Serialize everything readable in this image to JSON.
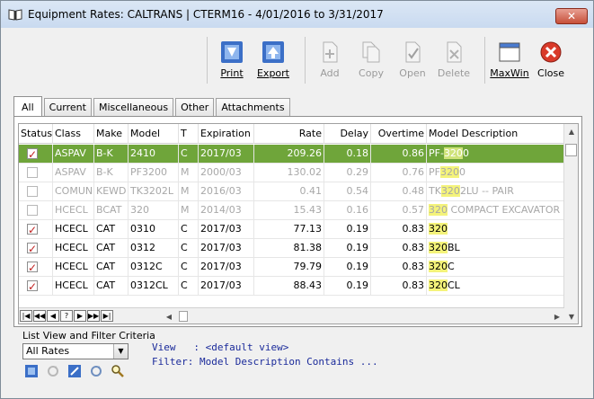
{
  "window": {
    "title": "Equipment Rates: CALTRANS | CTERM16 -  4/01/2016 to  3/31/2017",
    "close_glyph": "✕"
  },
  "toolbar": {
    "print": "Print",
    "export": "Export",
    "add": "Add",
    "copy": "Copy",
    "open": "Open",
    "delete": "Delete",
    "maxwin": "MaxWin",
    "close": "Close"
  },
  "tabs": [
    "All",
    "Current",
    "Miscellaneous",
    "Other",
    "Attachments"
  ],
  "grid": {
    "columns": [
      "Status",
      "Class",
      "Make",
      "Model",
      "T",
      "Expiration",
      "Rate",
      "Delay",
      "Overtime",
      "Model Description"
    ],
    "rows": [
      {
        "checked": true,
        "class": "ASPAV",
        "make": "B-K",
        "model": "2410",
        "t": "C",
        "expiration": "2017/03",
        "rate": "209.26",
        "delay": "0.18",
        "overtime": "0.86",
        "desc_pre": "PF-",
        "desc_hl": "320",
        "desc_post": "0",
        "state": "selected"
      },
      {
        "checked": false,
        "class": "ASPAV",
        "make": "B-K",
        "model": "PF3200",
        "t": "M",
        "expiration": "2000/03",
        "rate": "130.02",
        "delay": "0.29",
        "overtime": "0.76",
        "desc_pre": "PF",
        "desc_hl": "320",
        "desc_post": "0",
        "state": "dim"
      },
      {
        "checked": false,
        "class": "COMUN",
        "make": "KEWD",
        "model": "TK3202L",
        "t": "M",
        "expiration": "2016/03",
        "rate": "0.41",
        "delay": "0.54",
        "overtime": "0.48",
        "desc_pre": "TK",
        "desc_hl": "320",
        "desc_post": "2LU -- PAIR",
        "state": "dim"
      },
      {
        "checked": false,
        "class": "HCECL",
        "make": "BCAT",
        "model": "320",
        "t": "M",
        "expiration": "2014/03",
        "rate": "15.43",
        "delay": "0.16",
        "overtime": "0.57",
        "desc_pre": "",
        "desc_hl": "320",
        "desc_post": " COMPACT EXCAVATOR",
        "state": "dim"
      },
      {
        "checked": true,
        "class": "HCECL",
        "make": "CAT",
        "model": "0310",
        "t": "C",
        "expiration": "2017/03",
        "rate": "77.13",
        "delay": "0.19",
        "overtime": "0.83",
        "desc_pre": "",
        "desc_hl": "320",
        "desc_post": "",
        "state": "normal"
      },
      {
        "checked": true,
        "class": "HCECL",
        "make": "CAT",
        "model": "0312",
        "t": "C",
        "expiration": "2017/03",
        "rate": "81.38",
        "delay": "0.19",
        "overtime": "0.83",
        "desc_pre": "",
        "desc_hl": "320",
        "desc_post": "BL",
        "state": "normal"
      },
      {
        "checked": true,
        "class": "HCECL",
        "make": "CAT",
        "model": "0312C",
        "t": "C",
        "expiration": "2017/03",
        "rate": "79.79",
        "delay": "0.19",
        "overtime": "0.83",
        "desc_pre": "",
        "desc_hl": "320",
        "desc_post": "C",
        "state": "normal"
      },
      {
        "checked": true,
        "class": "HCECL",
        "make": "CAT",
        "model": "0312CL",
        "t": "C",
        "expiration": "2017/03",
        "rate": "88.43",
        "delay": "0.19",
        "overtime": "0.83",
        "desc_pre": "",
        "desc_hl": "320",
        "desc_post": "CL",
        "state": "normal"
      }
    ]
  },
  "navbar": [
    "|◀",
    "◀◀",
    "◀",
    "?",
    "▶",
    "▶▶",
    "▶|"
  ],
  "filter": {
    "label": "List View and Filter Criteria",
    "selected": "All Rates",
    "view_line": "View   : <default view>",
    "filter_line": "Filter: Model Description Contains ..."
  }
}
